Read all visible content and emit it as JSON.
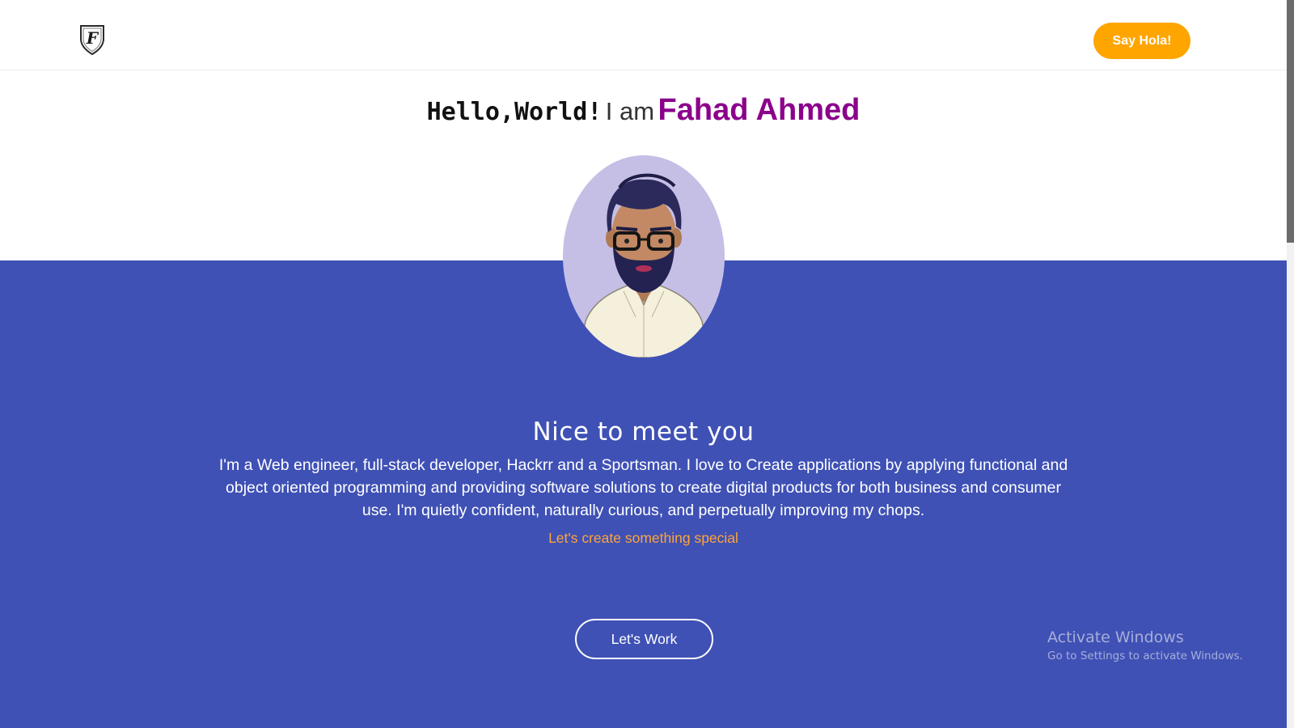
{
  "header": {
    "logo_icon": "shield-f-logo-icon",
    "cta_label": "Say Hola!"
  },
  "hero": {
    "greeting": "Hello,World!",
    "intro": "I am",
    "name": "Fahad Ahmed",
    "avatar_icon": "cartoon-avatar-portrait"
  },
  "about": {
    "title": "Nice to meet you",
    "bio": "I'm a Web engineer, full-stack developer, Hackrr and a Sportsman. I love to Create applications by applying functional and object oriented programming and providing software solutions to create digital products for both business and consumer use. I'm quietly confident, naturally curious, and perpetually improving my chops.",
    "tagline": "Let's create something special",
    "button_label": "Let's Work"
  },
  "watermark": {
    "title": "Activate Windows",
    "subtitle": "Go to Settings to activate Windows."
  },
  "colors": {
    "accent_orange": "#ffa500",
    "name_purple": "#8b008b",
    "section_blue": "#3f51b5",
    "avatar_bg": "#c5bfe6"
  }
}
